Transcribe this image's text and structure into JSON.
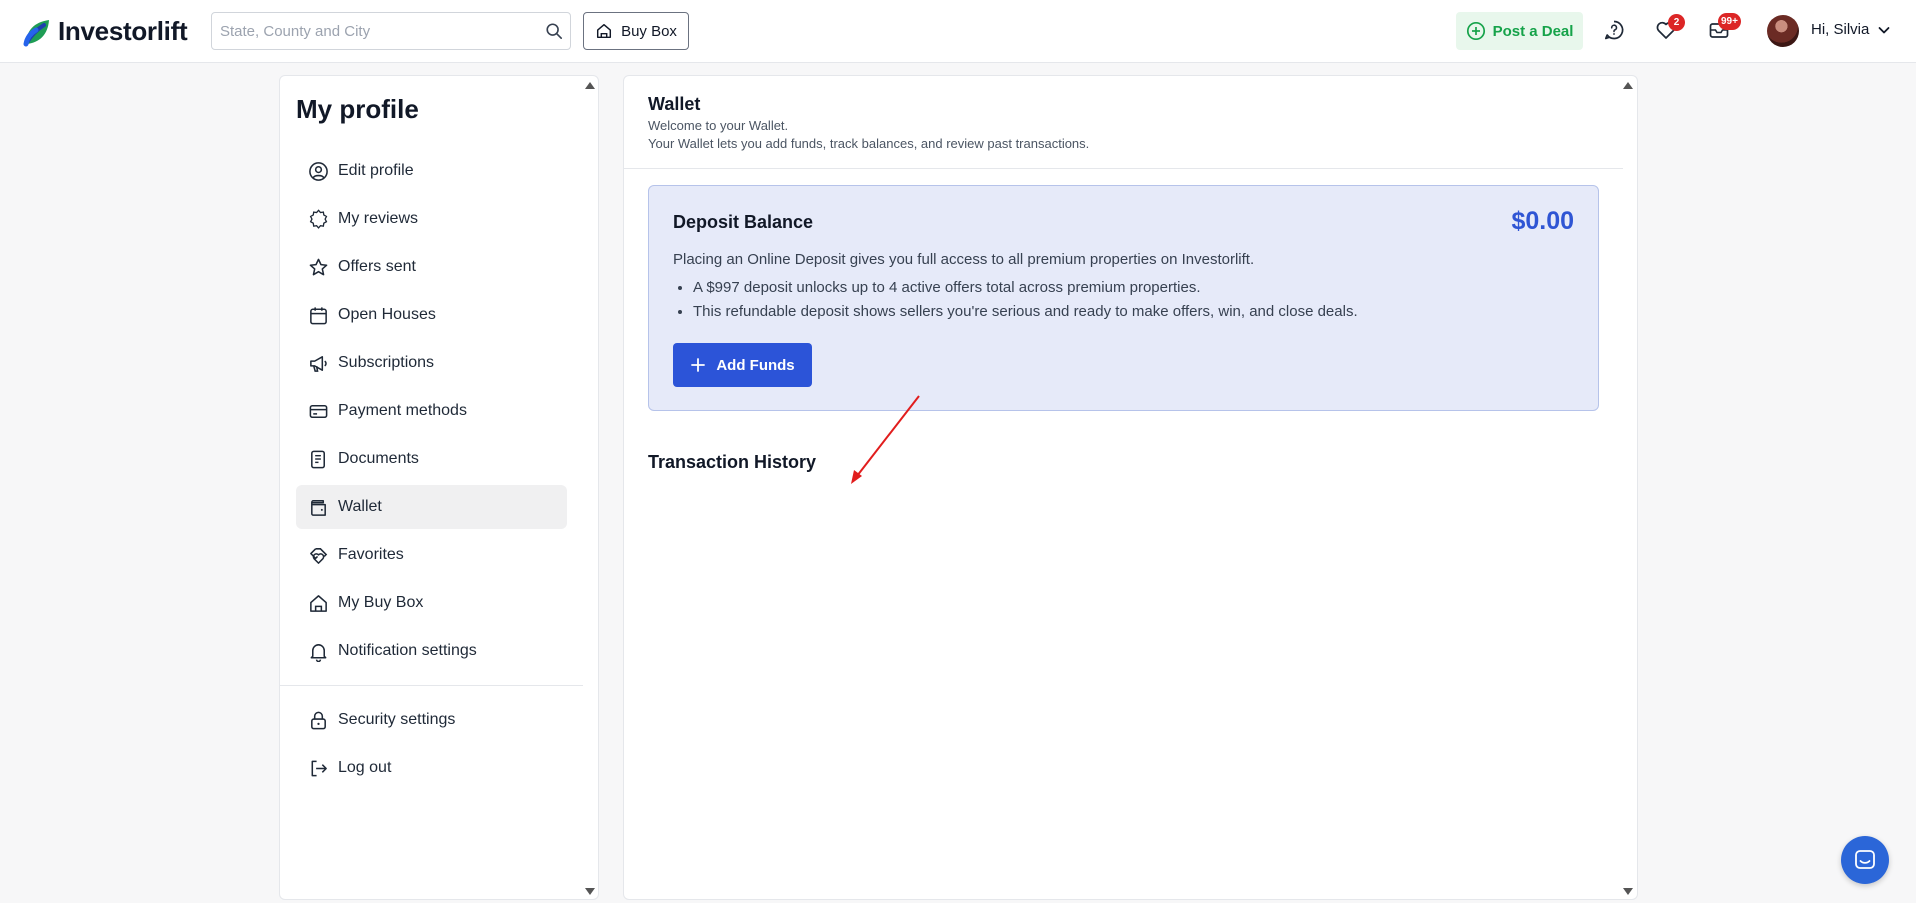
{
  "header": {
    "brand": "Investorlift",
    "search_placeholder": "State, County and City",
    "buy_box_label": "Buy Box",
    "post_deal_label": "Post a Deal",
    "favorites_badge": "2",
    "messages_badge": "99+",
    "greeting": "Hi, Silvia"
  },
  "sidebar": {
    "title": "My profile",
    "items": [
      {
        "label": "Edit profile",
        "icon": "user-circle-icon"
      },
      {
        "label": "My reviews",
        "icon": "badge-star-icon"
      },
      {
        "label": "Offers sent",
        "icon": "star-icon"
      },
      {
        "label": "Open Houses",
        "icon": "calendar-icon"
      },
      {
        "label": "Subscriptions",
        "icon": "megaphone-icon"
      },
      {
        "label": "Payment methods",
        "icon": "credit-card-icon"
      },
      {
        "label": "Documents",
        "icon": "documents-icon"
      },
      {
        "label": "Wallet",
        "icon": "wallet-icon",
        "active": true
      },
      {
        "label": "Favorites",
        "icon": "favorites-icon"
      },
      {
        "label": "My Buy Box",
        "icon": "home-icon"
      },
      {
        "label": "Notification settings",
        "icon": "bell-icon"
      },
      {
        "label": "Security settings",
        "icon": "lock-icon"
      },
      {
        "label": "Log out",
        "icon": "logout-icon"
      }
    ]
  },
  "main": {
    "title": "Wallet",
    "subtitle1": "Welcome to your Wallet.",
    "subtitle2": "Your Wallet lets you add funds, track balances, and review past transactions.",
    "deposit": {
      "title": "Deposit Balance",
      "amount": "$0.00",
      "description": "Placing an Online Deposit gives you full access to all premium properties on Investorlift.",
      "bullets": [
        "A $997 deposit unlocks up to 4 active offers total across premium properties.",
        "This refundable deposit shows sellers you're serious and ready to make offers, win, and close deals."
      ],
      "add_funds_label": "Add Funds"
    },
    "transaction_history_title": "Transaction History"
  },
  "colors": {
    "accent": "#2c54d8",
    "amount": "#2f55d4",
    "deposit_bg": "#e6eaf9",
    "post_deal_green": "#16a34a",
    "badge_red": "#dc2626",
    "annotation_red": "#e11d1d"
  }
}
